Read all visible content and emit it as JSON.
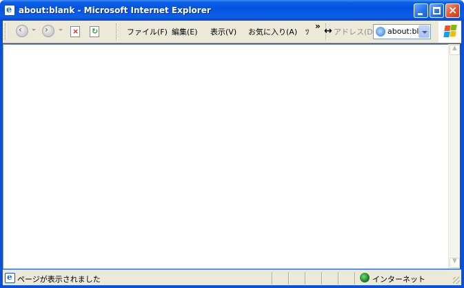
{
  "window": {
    "title": "about:blank - Microsoft Internet Explorer"
  },
  "title_buttons": {
    "minimize": "minimize-icon",
    "maximize": "maximize-icon",
    "close": "close-icon"
  },
  "toolbar": {
    "back_icon": "back-arrow-icon",
    "forward_icon": "forward-arrow-icon",
    "stop_icon": "stop-icon",
    "refresh_icon": "refresh-icon",
    "menus": [
      "ファイル(F)",
      "編集(E)",
      "表示(V)",
      "お気に入り(A)",
      "ﾂ"
    ],
    "chevron": "»",
    "address_label": "アドレス(D)",
    "address_value": "about:blank"
  },
  "status": {
    "text": "ページが表示されました",
    "zone": "インターネット"
  },
  "colors": {
    "titlebar": "#0553e0",
    "toolbar_bg": "#ece9d8",
    "close_button": "#e1532f"
  }
}
